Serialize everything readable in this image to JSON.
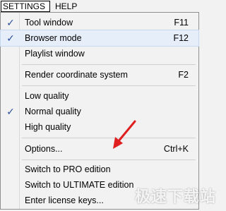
{
  "menubar": {
    "settings_label": "SETTINGS",
    "help_label": "HELP"
  },
  "menu": {
    "tool_window": {
      "label": "Tool window",
      "shortcut": "F11",
      "checked": true
    },
    "browser_mode": {
      "label": "Browser mode",
      "shortcut": "F12",
      "checked": true
    },
    "playlist_window": {
      "label": "Playlist window"
    },
    "render_coordinate_system": {
      "label": "Render coordinate system",
      "shortcut": "F2"
    },
    "low_quality": {
      "label": "Low quality"
    },
    "normal_quality": {
      "label": "Normal quality",
      "checked": true
    },
    "high_quality": {
      "label": "High quality"
    },
    "options": {
      "label": "Options...",
      "shortcut": "Ctrl+K"
    },
    "switch_pro": {
      "label": "Switch to PRO edition"
    },
    "switch_ultimate": {
      "label": "Switch to ULTIMATE edition"
    },
    "enter_license": {
      "label": "Enter license keys..."
    }
  },
  "check_glyph": "✓",
  "icons": {
    "check": "checkmark-icon",
    "annotation": "red-arrow-annotation"
  },
  "colors": {
    "highlight": "#e6eef9",
    "check": "#2b4f9b",
    "annotation": "#e02020"
  },
  "watermark": "极速下载站"
}
